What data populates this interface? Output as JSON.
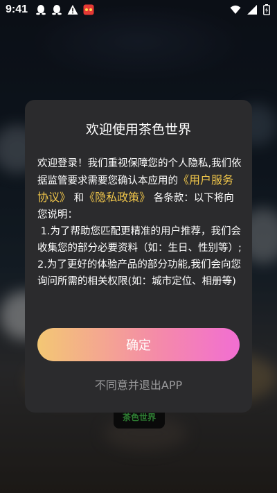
{
  "status_bar": {
    "time": "9:41",
    "left_icons": [
      "qq-penguin-icon",
      "qq-penguin-icon",
      "warning-icon",
      "app-notification-icon"
    ],
    "right_icons": [
      "wifi-icon",
      "signal-icon",
      "battery-icon"
    ]
  },
  "background": {
    "app_logo_text": "茶色世界"
  },
  "dialog": {
    "title": "欢迎使用茶色世界",
    "intro_before_link": "欢迎登录！我们重视保障您的个人隐私,我们依据监管要求需要您确认本应用的",
    "user_agreement_link": "《用户服务协议》",
    "and_text": "和",
    "privacy_policy_link": "《隐私政策》",
    "intro_after_link": "各条款：以下将向您说明：",
    "item1": " 1.为了帮助您匹配更精准的用户推荐，我们会收集您的部分必要资料（如：生日、性别等）;",
    "item2": "2.为了更好的体验产品的部分功能,我们会向您询问所需的相关权限(如：城市定位、相册等)",
    "confirm_label": "确定",
    "decline_label": "不同意并退出APP"
  },
  "colors": {
    "dialog_bg": "#2b2b2d",
    "link": "#f0c64a",
    "button_gradient_start": "#f3c774",
    "button_gradient_end": "#f26ed2",
    "decline_text": "#9a9a9c"
  }
}
